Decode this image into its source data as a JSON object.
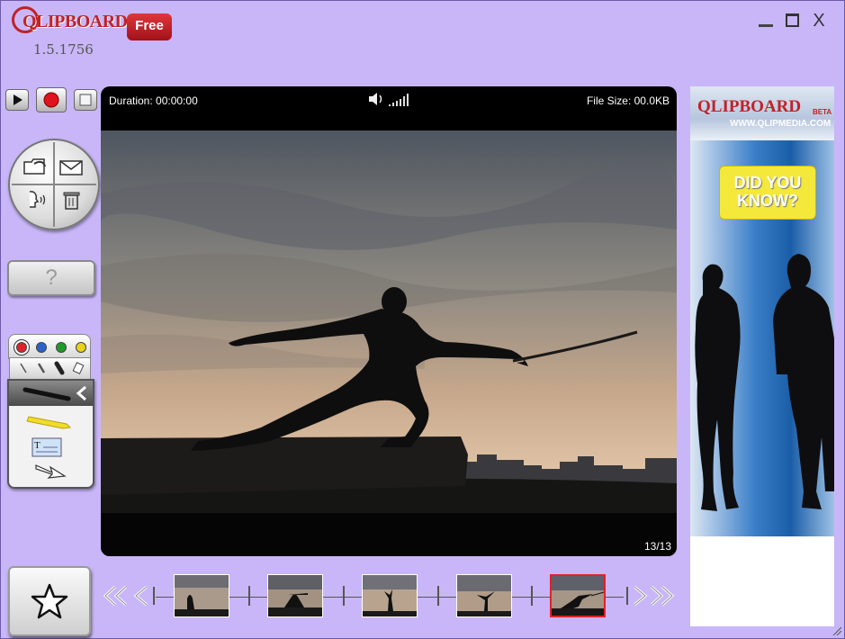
{
  "app": {
    "logo_text": "QLIPBOARD",
    "badge": "Free",
    "version": "1.5.1756"
  },
  "window_controls": {
    "minimize": "minimize",
    "maximize": "maximize",
    "close": "X"
  },
  "player": {
    "duration_label": "Duration: 00:00:00",
    "file_size_label": "File Size: 00.0KB",
    "counter": "13/13"
  },
  "help": {
    "label": "?"
  },
  "colors": {
    "window_bg": "#c8b6f8",
    "palette": [
      "#e0222a",
      "#2a62c8",
      "#1f9a2a",
      "#e8d21a"
    ],
    "selected_thumb_border": "#e0222a"
  },
  "filmstrip": {
    "thumbnails": [
      "thumb-1",
      "thumb-2",
      "thumb-3",
      "thumb-4",
      "thumb-5"
    ],
    "selected_index": 4
  },
  "ad": {
    "logo": "QLIPBOARD",
    "beta": "BETA",
    "url": "WWW.QLIPMEDIA.COM",
    "bubble_line1": "DID YOU",
    "bubble_line2": "KNOW?"
  }
}
